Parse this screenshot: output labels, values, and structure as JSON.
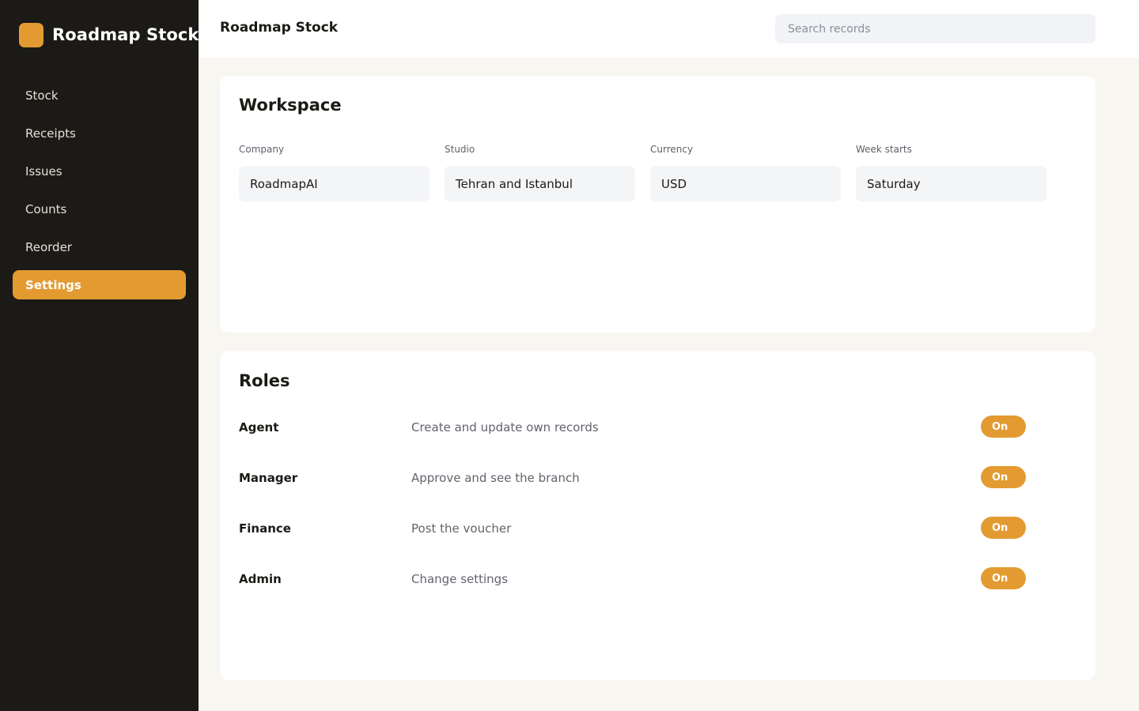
{
  "brand": {
    "name": "Roadmap Stock",
    "logo_icon": "brand-logo-icon",
    "accent": "#e39b31"
  },
  "sidebar": {
    "items": [
      {
        "label": "Stock",
        "active": false
      },
      {
        "label": "Receipts",
        "active": false
      },
      {
        "label": "Issues",
        "active": false
      },
      {
        "label": "Counts",
        "active": false
      },
      {
        "label": "Reorder",
        "active": false
      },
      {
        "label": "Settings",
        "active": true
      }
    ]
  },
  "header": {
    "title": "Roadmap Stock",
    "search_placeholder": "Search records"
  },
  "workspace": {
    "title": "Workspace",
    "fields": [
      {
        "label": "Company",
        "value": "RoadmapAI"
      },
      {
        "label": "Studio",
        "value": "Tehran and Istanbul"
      },
      {
        "label": "Currency",
        "value": "USD"
      },
      {
        "label": "Week starts",
        "value": "Saturday"
      }
    ]
  },
  "roles": {
    "title": "Roles",
    "items": [
      {
        "name": "Agent",
        "description": "Create and update own records",
        "toggle": "On"
      },
      {
        "name": "Manager",
        "description": "Approve and see the branch",
        "toggle": "On"
      },
      {
        "name": "Finance",
        "description": "Post the voucher",
        "toggle": "On"
      },
      {
        "name": "Admin",
        "description": "Change settings",
        "toggle": "On"
      }
    ]
  }
}
